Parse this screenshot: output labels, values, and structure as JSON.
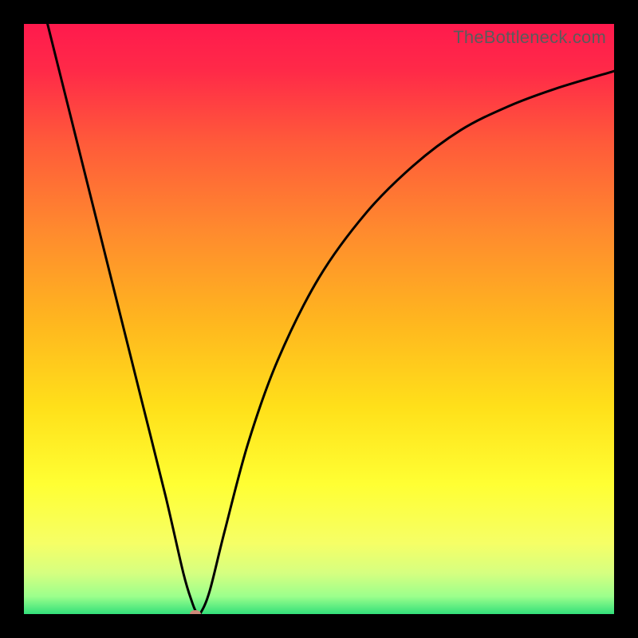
{
  "attribution": "TheBottleneck.com",
  "chart_data": {
    "type": "line",
    "title": "",
    "xlabel": "",
    "ylabel": "",
    "xlim": [
      0,
      100
    ],
    "ylim": [
      0,
      100
    ],
    "background_gradient": {
      "stops": [
        {
          "pos": 0.0,
          "color": "#ff1a4d"
        },
        {
          "pos": 0.08,
          "color": "#ff2a48"
        },
        {
          "pos": 0.2,
          "color": "#ff5a3a"
        },
        {
          "pos": 0.35,
          "color": "#ff8a2e"
        },
        {
          "pos": 0.5,
          "color": "#ffb51f"
        },
        {
          "pos": 0.65,
          "color": "#ffe01a"
        },
        {
          "pos": 0.78,
          "color": "#ffff33"
        },
        {
          "pos": 0.88,
          "color": "#f6ff66"
        },
        {
          "pos": 0.93,
          "color": "#d6ff80"
        },
        {
          "pos": 0.97,
          "color": "#9cff8c"
        },
        {
          "pos": 1.0,
          "color": "#33e07a"
        }
      ]
    },
    "series": [
      {
        "name": "bottleneck-curve",
        "color": "#000000",
        "stroke_width": 3,
        "x": [
          4.0,
          8.0,
          12.0,
          16.0,
          20.0,
          24.0,
          27.0,
          28.5,
          29.3,
          30.0,
          31.5,
          34.0,
          38.0,
          43.0,
          50.0,
          58.0,
          66.0,
          74.0,
          82.0,
          90.0,
          100.0
        ],
        "values": [
          100.0,
          84.0,
          68.0,
          52.0,
          36.0,
          20.0,
          7.0,
          2.0,
          0.2,
          0.3,
          4.0,
          14.0,
          29.0,
          43.0,
          57.0,
          68.0,
          76.0,
          82.0,
          86.0,
          89.0,
          92.0
        ]
      }
    ],
    "marker": {
      "x": 29.0,
      "y": 0.0,
      "color": "#cf8a7a"
    }
  }
}
